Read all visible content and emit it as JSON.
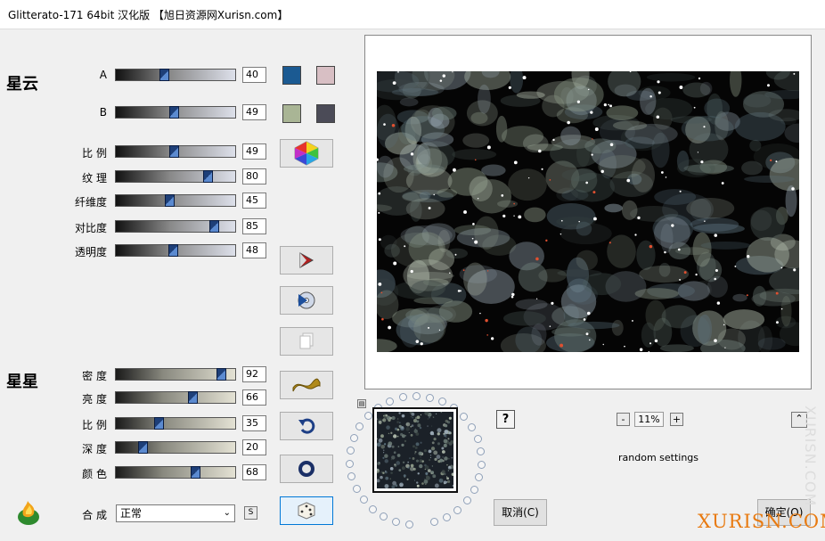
{
  "window": {
    "title": "Glitterato-171 64bit 汉化版 【旭日资源网Xurisn.com】"
  },
  "nebula": {
    "heading": "星云",
    "rows": [
      {
        "label": "A",
        "value": "40",
        "kind": "neb"
      },
      {
        "label": "B",
        "value": "49",
        "kind": "neb"
      },
      {
        "label": "比 例",
        "value": "49",
        "kind": "neb"
      },
      {
        "label": "纹 理",
        "value": "80",
        "kind": "neb"
      },
      {
        "label": "纤维度",
        "value": "45",
        "kind": "neb"
      },
      {
        "label": "对比度",
        "value": "85",
        "kind": "neb"
      },
      {
        "label": "透明度",
        "value": "48",
        "kind": "neb"
      }
    ],
    "colors": {
      "a1": "#1b5a92",
      "a2": "#d8bfc4",
      "b1": "#a9b595",
      "b2": "#4b4b57"
    }
  },
  "stars": {
    "heading": "星星",
    "rows": [
      {
        "label": "密 度",
        "value": "92",
        "kind": "star"
      },
      {
        "label": "亮 度",
        "value": "66",
        "kind": "star"
      },
      {
        "label": "比 例",
        "value": "35",
        "kind": "star"
      },
      {
        "label": "深 度",
        "value": "20",
        "kind": "star"
      },
      {
        "label": "颜 色",
        "value": "68",
        "kind": "star"
      }
    ]
  },
  "blend": {
    "label": "合 成",
    "value": "正常",
    "extra": "S"
  },
  "zoom": {
    "minus": "-",
    "value": "11%",
    "plus": "+"
  },
  "help": "?",
  "random_settings": "random settings",
  "buttons": {
    "cancel": "取消(C)",
    "ok": "确定(O)"
  },
  "watermark": {
    "text": "XURISN.COM",
    "vertical": "XURISN.COM"
  },
  "icons": [
    "color-hexagon-icon",
    "play-icon",
    "cd-icon",
    "copy-icon",
    "wave-icon",
    "undo-icon",
    "ring-icon",
    "dice-icon",
    "flame-logo-icon"
  ]
}
